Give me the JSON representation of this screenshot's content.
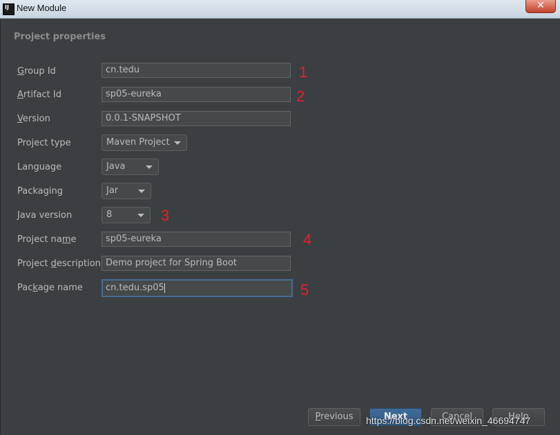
{
  "window": {
    "title": "New Module",
    "close_symbol": "✕"
  },
  "section_title": "Project properties",
  "fields": {
    "group_id": {
      "label": "Group Id",
      "value": "cn.tedu"
    },
    "artifact_id": {
      "label": "Artifact Id",
      "value": "sp05-eureka"
    },
    "version": {
      "label": "Version",
      "value": "0.0.1-SNAPSHOT"
    },
    "project_type": {
      "label": "Project type",
      "value": "Maven Project"
    },
    "language": {
      "label": "Language",
      "value": "Java"
    },
    "packaging": {
      "label": "Packaging",
      "value": "Jar"
    },
    "java_version": {
      "label": "Java version",
      "value": "8"
    },
    "project_name": {
      "label": "Project name",
      "value": "sp05-eureka"
    },
    "project_description": {
      "label": "Project description",
      "value": "Demo project for Spring Boot"
    },
    "package_name": {
      "label": "Package name",
      "value": "cn.tedu.sp05"
    }
  },
  "annotations": [
    "1",
    "2",
    "3",
    "4",
    "5"
  ],
  "buttons": {
    "previous": "Previous",
    "next": "Next",
    "cancel": "Cancel",
    "help": "Help"
  },
  "watermark": "https://blog.csdn.net/weixin_46694747",
  "colors": {
    "background": "#3c3f41",
    "annotation": "#e3232c",
    "focus_border": "#466d94",
    "default_button": "#365f88"
  },
  "icons": {
    "app": "intellij-idea-icon",
    "dropdown": "chevron-down-icon",
    "close": "close-icon"
  }
}
